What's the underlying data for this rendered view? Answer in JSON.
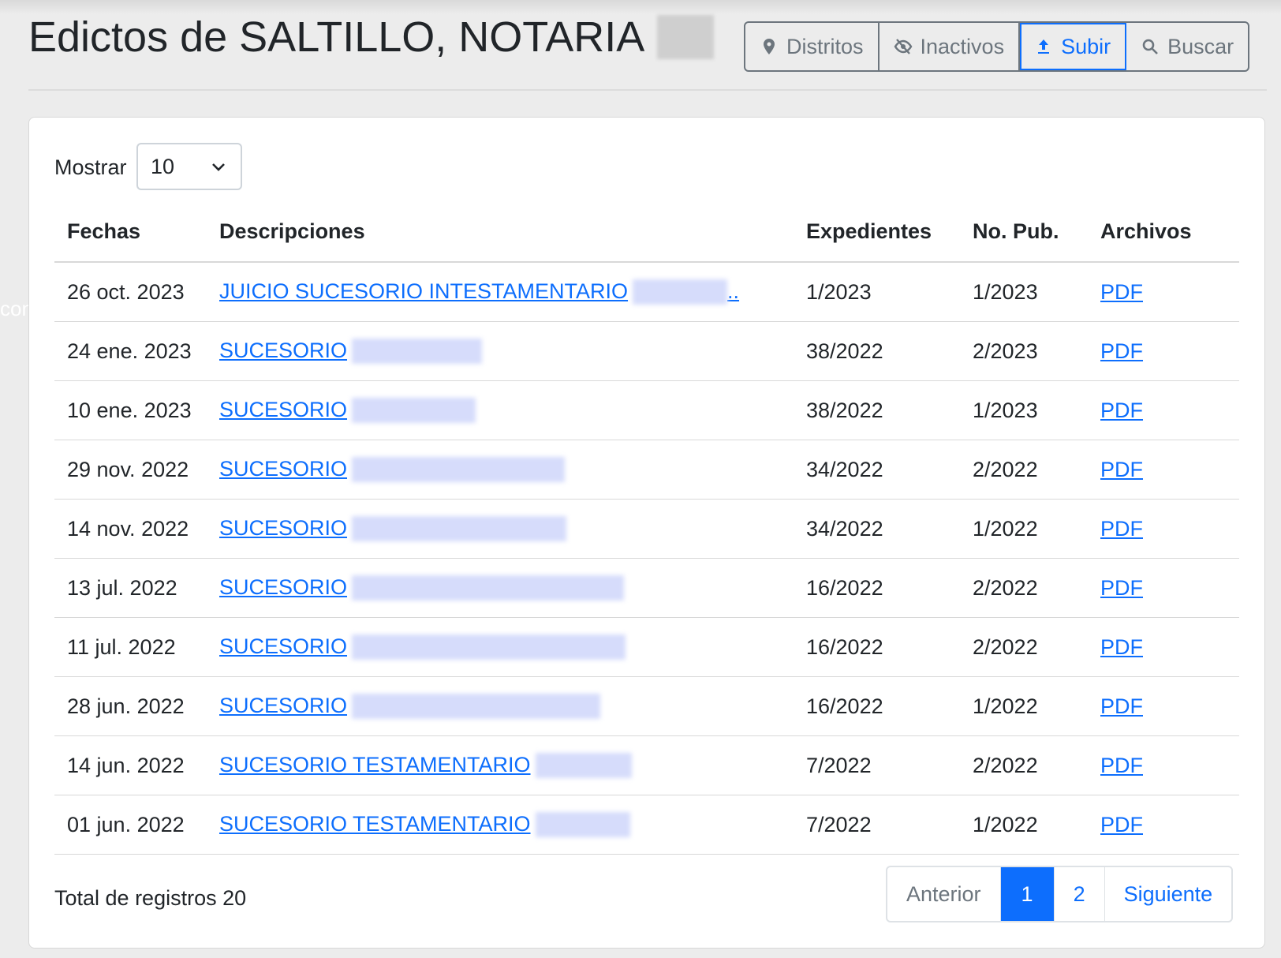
{
  "header": {
    "title": "Edictos de SALTILLO, NOTARIA",
    "buttons": {
      "districts": "Distritos",
      "inactive": "Inactivos",
      "upload": "Subir",
      "search": "Buscar"
    }
  },
  "length": {
    "label": "Mostrar",
    "value": "10"
  },
  "table": {
    "headers": [
      "Fechas",
      "Descripciones",
      "Expedientes",
      "No. Pub.",
      "Archivos"
    ],
    "rows": [
      {
        "date": "26 oct. 2023",
        "desc": "JUICIO SUCESORIO INTESTAMENTARIO",
        "suffix": "..",
        "exp": "1/2023",
        "pub": "1/2023",
        "file": "PDF"
      },
      {
        "date": "24 ene. 2023",
        "desc": "SUCESORIO",
        "suffix": "",
        "exp": "38/2022",
        "pub": "2/2023",
        "file": "PDF"
      },
      {
        "date": "10 ene. 2023",
        "desc": "SUCESORIO",
        "suffix": "",
        "exp": "38/2022",
        "pub": "1/2023",
        "file": "PDF"
      },
      {
        "date": "29 nov. 2022",
        "desc": "SUCESORIO",
        "suffix": "",
        "exp": "34/2022",
        "pub": "2/2022",
        "file": "PDF"
      },
      {
        "date": "14 nov. 2022",
        "desc": "SUCESORIO",
        "suffix": "",
        "exp": "34/2022",
        "pub": "1/2022",
        "file": "PDF"
      },
      {
        "date": "13 jul. 2022",
        "desc": "SUCESORIO",
        "suffix": "",
        "exp": "16/2022",
        "pub": "2/2022",
        "file": "PDF"
      },
      {
        "date": "11 jul. 2022",
        "desc": "SUCESORIO",
        "suffix": "",
        "exp": "16/2022",
        "pub": "2/2022",
        "file": "PDF"
      },
      {
        "date": "28 jun. 2022",
        "desc": "SUCESORIO",
        "suffix": "",
        "exp": "16/2022",
        "pub": "1/2022",
        "file": "PDF"
      },
      {
        "date": "14 jun. 2022",
        "desc": "SUCESORIO TESTAMENTARIO",
        "suffix": "",
        "exp": "7/2022",
        "pub": "2/2022",
        "file": "PDF"
      },
      {
        "date": "01 jun. 2022",
        "desc": "SUCESORIO TESTAMENTARIO",
        "suffix": "",
        "exp": "7/2022",
        "pub": "1/2022",
        "file": "PDF"
      }
    ]
  },
  "footer": {
    "total": "Total de registros 20",
    "pagination": {
      "prev": "Anterior",
      "pages": [
        "1",
        "2"
      ],
      "next": "Siguiente"
    }
  },
  "edge_text": "con"
}
